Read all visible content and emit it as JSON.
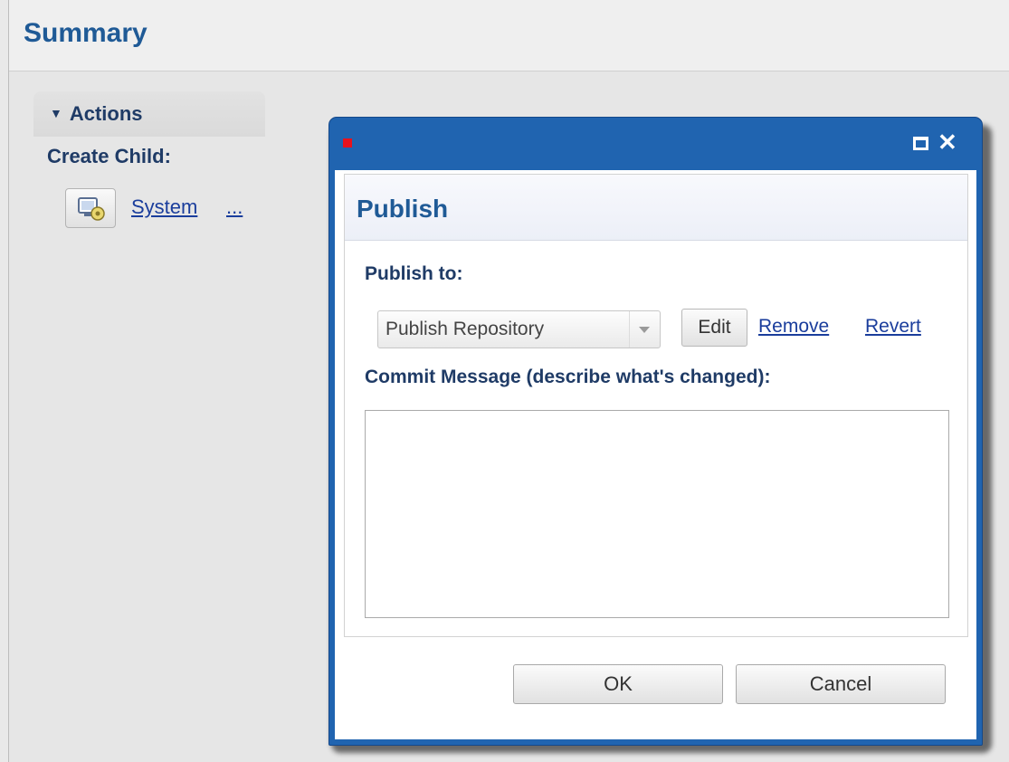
{
  "page": {
    "title": "Summary"
  },
  "sidebar": {
    "actions_label": "Actions",
    "create_child_label": "Create Child:",
    "system_link": "System",
    "more_link": "..."
  },
  "dialog": {
    "panel_title": "Publish",
    "publish_to_label": "Publish to:",
    "repository_select": {
      "selected": "Publish Repository"
    },
    "edit_label": "Edit",
    "remove_label": "Remove",
    "revert_label": "Revert",
    "commit_label": "Commit Message (describe what's changed):",
    "commit_value": "",
    "ok_label": "OK",
    "cancel_label": "Cancel",
    "icons": {
      "maximize": "maximize-icon",
      "close": "close-icon"
    }
  },
  "colors": {
    "title_blue": "#1f5a96",
    "label_navy": "#1f3b66",
    "link_blue": "#1a3d9c",
    "dialog_frame": "#2064b0",
    "indicator_red": "#e8121c"
  }
}
